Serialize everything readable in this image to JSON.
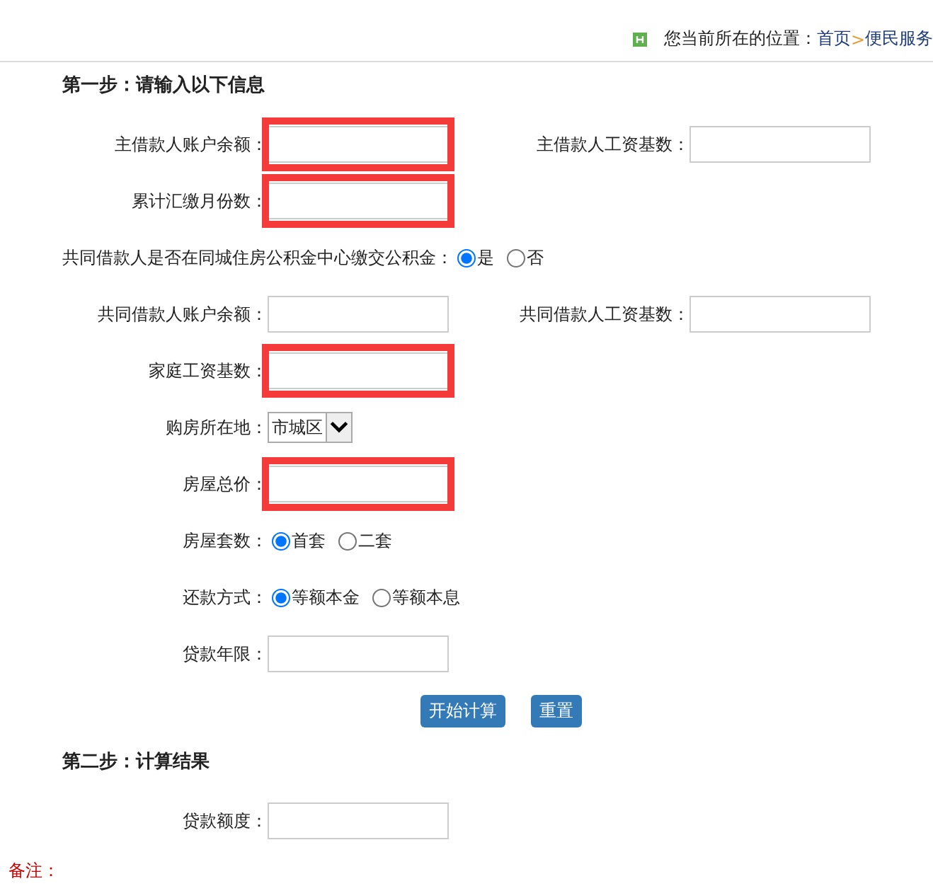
{
  "breadcrumb": {
    "prefix": "您当前所在的位置：",
    "links": [
      {
        "label": "首页"
      },
      {
        "label": "便民服务"
      }
    ],
    "separator": ">"
  },
  "sections": [
    {
      "title": "第一步：请输入以下信息",
      "rows": [
        {
          "kind": "fields",
          "fields": [
            {
              "label": "主借款人账户余额：",
              "highlighted": true
            },
            {
              "label": "主借款人工资基数：",
              "highlighted": false
            }
          ]
        },
        {
          "kind": "fields",
          "fields": [
            {
              "label": "累计汇缴月份数：",
              "highlighted": true
            }
          ]
        },
        {
          "kind": "question",
          "label": "共同借款人是否在同城住房公积金中心缴交公积金：",
          "options": [
            {
              "label": "是",
              "selected": true
            },
            {
              "label": "否",
              "selected": false
            }
          ]
        },
        {
          "kind": "fields",
          "fields": [
            {
              "label": "共同借款人账户余额：",
              "highlighted": false
            },
            {
              "label": "共同借款人工资基数：",
              "highlighted": false
            }
          ]
        },
        {
          "kind": "fields",
          "fields": [
            {
              "label": "家庭工资基数：",
              "highlighted": true
            }
          ]
        },
        {
          "kind": "select",
          "label": "购房所在地：",
          "value": "市城区"
        },
        {
          "kind": "fields",
          "fields": [
            {
              "label": "房屋总价：",
              "highlighted": true
            }
          ]
        },
        {
          "kind": "radios",
          "label": "房屋套数：",
          "options": [
            {
              "label": "首套",
              "selected": true
            },
            {
              "label": "二套",
              "selected": false
            }
          ]
        },
        {
          "kind": "radios",
          "label": "还款方式：",
          "options": [
            {
              "label": "等额本金",
              "selected": true
            },
            {
              "label": "等额本息",
              "selected": false
            }
          ]
        },
        {
          "kind": "fields",
          "fields": [
            {
              "label": "贷款年限：",
              "highlighted": false
            }
          ]
        },
        {
          "kind": "buttons",
          "buttons": [
            {
              "label": "开始计算"
            },
            {
              "label": "重置"
            }
          ]
        }
      ]
    },
    {
      "title": "第二步：计算结果",
      "rows": [
        {
          "kind": "fields",
          "fields": [
            {
              "label": "贷款额度：",
              "highlighted": false
            }
          ]
        }
      ]
    }
  ],
  "note": "备注："
}
